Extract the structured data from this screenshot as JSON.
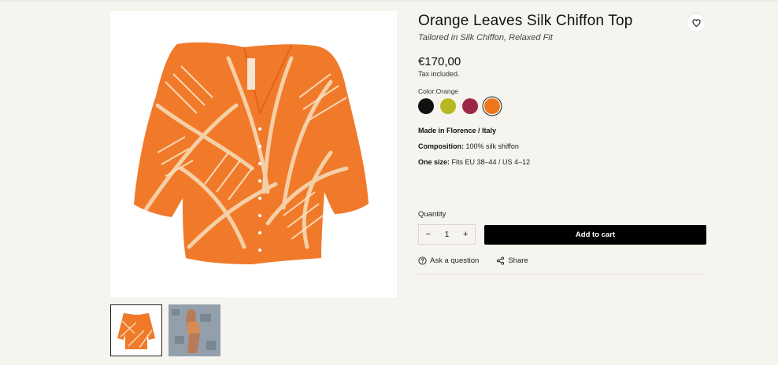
{
  "product": {
    "title": "Orange Leaves Silk Chiffon Top",
    "subtitle": "Tailored in Silk Chiffon, Relaxed Fit",
    "price": "€170,00",
    "tax_note": "Tax included."
  },
  "color": {
    "label": "Color:Orange",
    "swatches": [
      {
        "name": "Black",
        "hex": "#111111",
        "selected": false
      },
      {
        "name": "Lime",
        "hex": "#b5b81f",
        "selected": false
      },
      {
        "name": "Burgundy",
        "hex": "#9b2945",
        "selected": false
      },
      {
        "name": "Orange",
        "hex": "#f0761e",
        "selected": true
      }
    ]
  },
  "specs": {
    "origin": "Made in Florence / Italy",
    "composition_label": "Composition:",
    "composition_value": "100% silk shiffon",
    "size_label": "One size:",
    "size_value": "Fits EU 38–44 / US 4–12"
  },
  "quantity": {
    "label": "Quantity",
    "value": "1",
    "minus": "−",
    "plus": "+"
  },
  "cart": {
    "button_label": "Add to cart"
  },
  "actions": {
    "ask_label": "Ask a question",
    "share_label": "Share"
  },
  "icons": {
    "wishlist": "heart-icon",
    "ask": "question-circle-icon",
    "share": "share-icon"
  },
  "colors": {
    "background": "#f6f4ef",
    "accent_button": "#000000",
    "garment_orange": "#f07a2a",
    "garment_light": "#f6d9b4"
  }
}
